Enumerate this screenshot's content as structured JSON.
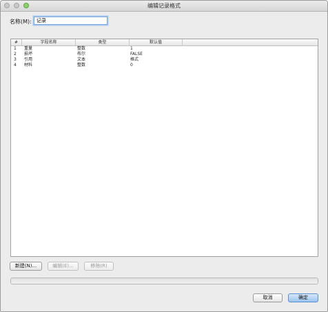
{
  "window": {
    "title": "编辑记录格式"
  },
  "form": {
    "name_label": "名称(M):",
    "name_value": "记录"
  },
  "table": {
    "headers": [
      "#",
      "字段名称",
      "类型",
      "默认值"
    ],
    "rows": [
      {
        "num": "1",
        "field": "重量",
        "type": "整数",
        "default": "1"
      },
      {
        "num": "2",
        "field": "损坏",
        "type": "布尔",
        "default": "FALSE"
      },
      {
        "num": "3",
        "field": "引用",
        "type": "文本",
        "default": "格式"
      },
      {
        "num": "4",
        "field": "材料",
        "type": "整数",
        "default": "0"
      }
    ]
  },
  "buttons": {
    "new": "新建(N)...",
    "edit": "编辑(E)...",
    "remove": "移除(R)",
    "cancel": "取消",
    "ok": "确定"
  }
}
